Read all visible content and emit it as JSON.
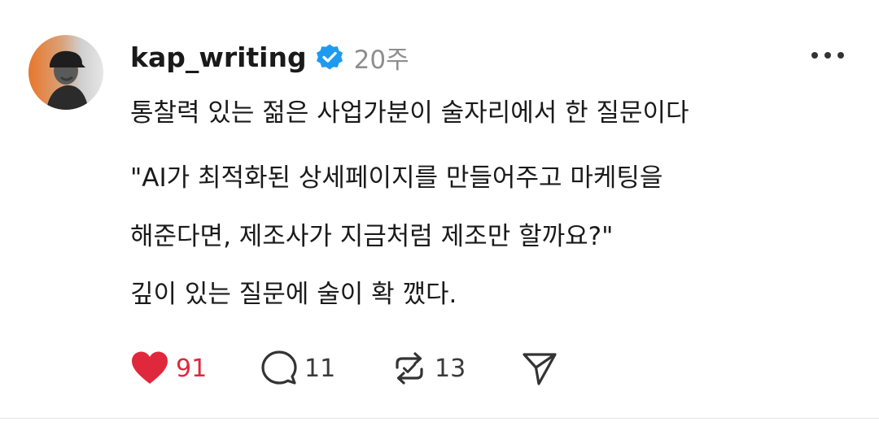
{
  "post": {
    "username": "kap_writing",
    "time": "20주",
    "paragraphs": [
      "통찰력 있는 젊은 사업가분이 술자리에서 한 질문이다",
      "\"AI가 최적화된 상세페이지를 만들어주고 마케팅을",
      "해준다면, 제조사가 지금처럼 제조만 할까요?\"",
      "깊이 있는 질문에 술이 확 깼다."
    ],
    "actions": {
      "likes": "91",
      "replies": "11",
      "reposts": "13"
    }
  },
  "icons": {
    "verified": "verified-badge-icon",
    "more": "more-options-icon",
    "like": "heart-icon",
    "reply": "comment-icon",
    "repost": "repost-icon",
    "share": "send-icon"
  },
  "colors": {
    "like_active": "#e0283c",
    "verified": "#1d9bf0",
    "muted": "#8e8e8e"
  }
}
